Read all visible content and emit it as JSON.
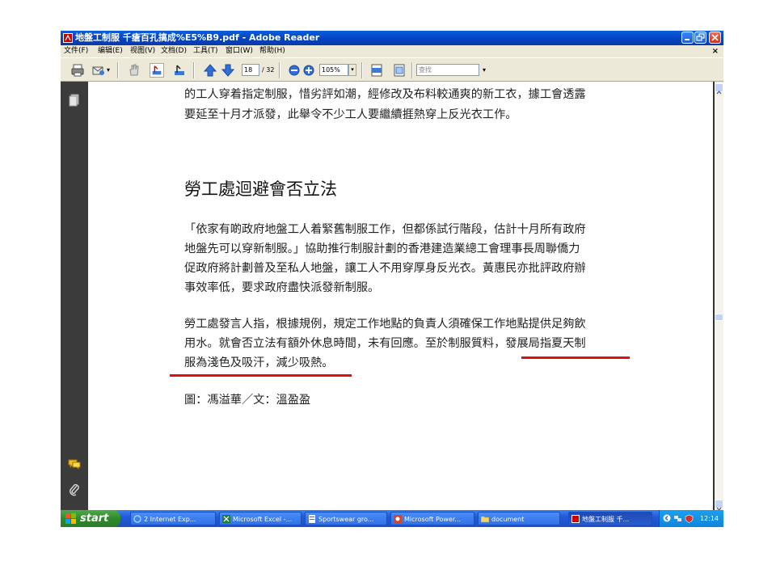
{
  "window": {
    "title": "地盤工制服 千瘡百孔搞成%E5%B9.pdf - Adobe Reader",
    "colors": {
      "titlebar": "#0443c0",
      "accent_red": "#e01010",
      "taskbar": "#2459d6",
      "start": "#2e8a2b"
    }
  },
  "menu": [
    "文件(F)",
    "编辑(E)",
    "视图(V)",
    "文档(D)",
    "工具(T)",
    "窗口(W)",
    "帮助(H)"
  ],
  "doc_close_label": "×",
  "toolbar": {
    "page_current": "18",
    "page_total": "/ 32",
    "zoom": "105%",
    "search_placeholder": "查找",
    "icons": [
      "print-icon",
      "email-icon",
      "hand-tool-icon",
      "select-tool-icon",
      "snapshot-icon",
      "prev-page-icon",
      "next-page-icon",
      "zoom-out-icon",
      "zoom-in-icon",
      "fit-page-icon",
      "fit-width-icon"
    ]
  },
  "document": {
    "para1_lines": [
      "的工人穿着指定制服，惜劣評如潮，經修改及布料較通爽的新工衣，據工會透露",
      "要延至十月才派發，此舉令不少工人要繼續捱熱穿上反光衣工作。"
    ],
    "heading": "勞工處迴避會否立法",
    "para2_lines": [
      "「依家有啲政府地盤工人着緊舊制服工作，但都係試行階段，估計十月所有政府",
      "地盤先可以穿新制服。」協助推行制服計劃的香港建造業總工會理事長周聯僑力",
      "促政府將計劃普及至私人地盤，讓工人不用穿厚身反光衣。黃惠民亦批評政府辦",
      "事效率低，要求政府盡快派發新制服。"
    ],
    "para3_lines": [
      "勞工處發言人指，根據規例，規定工作地點的負責人須確保工作地點提供足夠飲",
      "用水。就會否立法有額外休息時間，未有回應。至於制服質料，發展局指夏天制",
      "服為淺色及吸汗，減少吸熱。"
    ],
    "credit": "圖：馮溢華／文：溫盈盈"
  },
  "taskbar": {
    "start_label": "start",
    "tasks": [
      "2 Internet Exp...",
      "Microsoft Excel -...",
      "Sportswear gro...",
      "Microsoft Power...",
      "document",
      "地盤工制服 千..."
    ],
    "clock": "12:14"
  }
}
